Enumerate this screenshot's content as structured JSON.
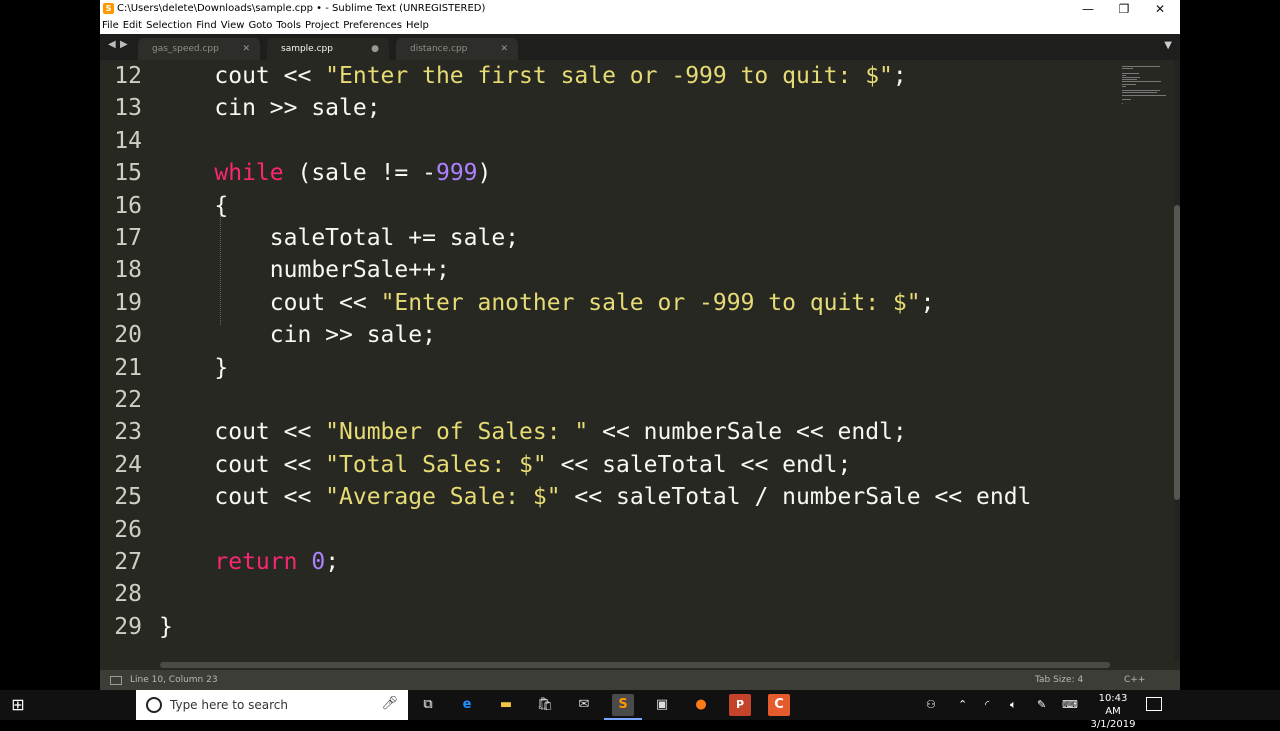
{
  "window": {
    "title": "C:\\Users\\delete\\Downloads\\sample.cpp • - Sublime Text (UNREGISTERED)",
    "app_icon": "S",
    "controls": {
      "minimize": "—",
      "maximize": "❐",
      "close": "✕"
    }
  },
  "menu": [
    "File",
    "Edit",
    "Selection",
    "Find",
    "View",
    "Goto",
    "Tools",
    "Project",
    "Preferences",
    "Help"
  ],
  "tabs": [
    {
      "label": "gas_speed.cpp",
      "close": "✕",
      "active": false
    },
    {
      "label": "sample.cpp",
      "close": "●",
      "active": true
    },
    {
      "label": "distance.cpp",
      "close": "✕",
      "active": false
    }
  ],
  "tab_nav": {
    "prev": "◀",
    "next": "▶",
    "dropdown": "▼"
  },
  "editor": {
    "line_numbers": [
      "12",
      "13",
      "14",
      "15",
      "16",
      "17",
      "18",
      "19",
      "20",
      "21",
      "22",
      "23",
      "24",
      "25",
      "26",
      "27",
      "28",
      "29"
    ],
    "lines": [
      [
        {
          "t": "    cout << ",
          "c": "plain"
        },
        {
          "t": "\"Enter the first sale or -999 to quit: $\"",
          "c": "str"
        },
        {
          "t": ";",
          "c": "plain"
        }
      ],
      [
        {
          "t": "    cin >> sale;",
          "c": "plain"
        }
      ],
      [
        {
          "t": "",
          "c": "plain"
        }
      ],
      [
        {
          "t": "    ",
          "c": "plain"
        },
        {
          "t": "while",
          "c": "kw"
        },
        {
          "t": " (sale != -",
          "c": "plain"
        },
        {
          "t": "999",
          "c": "num"
        },
        {
          "t": ")",
          "c": "plain"
        }
      ],
      [
        {
          "t": "    {",
          "c": "plain"
        }
      ],
      [
        {
          "t": "        saleTotal += sale;",
          "c": "plain"
        }
      ],
      [
        {
          "t": "        numberSale++;",
          "c": "plain"
        }
      ],
      [
        {
          "t": "        cout << ",
          "c": "plain"
        },
        {
          "t": "\"Enter another sale or -999 to quit: $\"",
          "c": "str"
        },
        {
          "t": ";",
          "c": "plain"
        }
      ],
      [
        {
          "t": "        cin >> sale;",
          "c": "plain"
        }
      ],
      [
        {
          "t": "    }",
          "c": "plain"
        }
      ],
      [
        {
          "t": "",
          "c": "plain"
        }
      ],
      [
        {
          "t": "    cout << ",
          "c": "plain"
        },
        {
          "t": "\"Number of Sales: \"",
          "c": "str"
        },
        {
          "t": " << numberSale << endl;",
          "c": "plain"
        }
      ],
      [
        {
          "t": "    cout << ",
          "c": "plain"
        },
        {
          "t": "\"Total Sales: $\"",
          "c": "str"
        },
        {
          "t": " << saleTotal << endl;",
          "c": "plain"
        }
      ],
      [
        {
          "t": "    cout << ",
          "c": "plain"
        },
        {
          "t": "\"Average Sale: $\"",
          "c": "str"
        },
        {
          "t": " << saleTotal / numberSale << endl",
          "c": "plain"
        }
      ],
      [
        {
          "t": "",
          "c": "plain"
        }
      ],
      [
        {
          "t": "    ",
          "c": "plain"
        },
        {
          "t": "return",
          "c": "kw"
        },
        {
          "t": " ",
          "c": "plain"
        },
        {
          "t": "0",
          "c": "num"
        },
        {
          "t": ";",
          "c": "plain"
        }
      ],
      [
        {
          "t": "",
          "c": "plain"
        }
      ],
      [
        {
          "t": "}",
          "c": "plain"
        }
      ]
    ]
  },
  "status": {
    "position": "Line 10, Column 23",
    "tab_size": "Tab Size: 4",
    "syntax": "C++"
  },
  "taskbar": {
    "start_icon": "windows-logo-icon",
    "search_placeholder": "Type here to search",
    "apps": [
      "task-view-icon",
      "edge-icon",
      "file-explorer-icon",
      "store-icon",
      "mail-icon",
      "sublime-text-icon",
      "terminal-icon",
      "firefox-icon",
      "powerpoint-icon",
      "app-icon"
    ],
    "time": "10:43 AM",
    "date": "3/1/2019"
  },
  "colors": {
    "editor_bg": "#272822",
    "keyword": "#f92672",
    "string": "#e6db74",
    "number": "#ae81ff",
    "text": "#f8f8f2"
  }
}
